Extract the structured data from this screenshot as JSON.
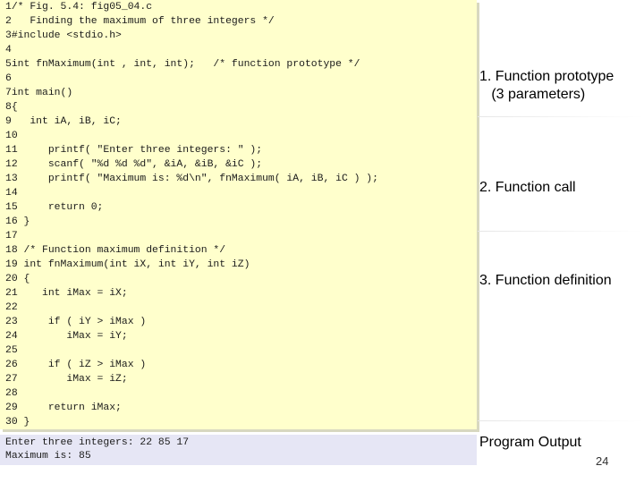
{
  "code": {
    "lines": [
      "1/* Fig. 5.4: fig05_04.c",
      "2   Finding the maximum of three integers */",
      "3#include <stdio.h>",
      "4",
      "5int fnMaximum(int , int, int);   /* function prototype */",
      "6",
      "7int main()",
      "8{",
      "9   int iA, iB, iC;",
      "10",
      "11     printf( \"Enter three integers: \" );",
      "12     scanf( \"%d %d %d\", &iA, &iB, &iC );",
      "13     printf( \"Maximum is: %d\\n\", fnMaximum( iA, iB, iC ) );",
      "14",
      "15     return 0;",
      "16 }",
      "17",
      "18 /* Function maximum definition */",
      "19 int fnMaximum(int iX, int iY, int iZ)",
      "20 {",
      "21    int iMax = iX;",
      "22",
      "23     if ( iY > iMax )",
      "24        iMax = iY;",
      "25",
      "26     if ( iZ > iMax )",
      "27        iMax = iZ;",
      "28",
      "29     return iMax;",
      "30 }"
    ]
  },
  "output": {
    "lines": [
      "Enter three integers: 22 85 17",
      "Maximum is: 85"
    ]
  },
  "sidebar": {
    "labels": [
      "1. Function prototype\n   (3 parameters)",
      "2. Function call",
      "3. Function definition",
      "Program Output"
    ]
  },
  "page_number": "24",
  "colors": {
    "code_background": "#ffffcc",
    "output_background": "#e6e6f5"
  }
}
